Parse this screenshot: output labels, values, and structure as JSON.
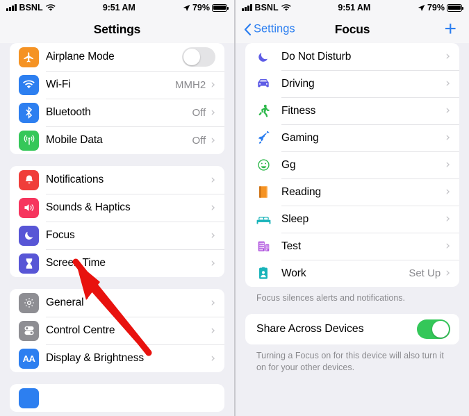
{
  "status_bar": {
    "carrier": "BSNL",
    "time": "9:51 AM",
    "battery_percent": "79%",
    "signal_icon": "cellular-bars-icon",
    "wifi_icon": "wifi-icon",
    "location_icon": "location-arrow-icon",
    "battery_icon": "battery-icon"
  },
  "left_screen": {
    "title": "Settings",
    "groups": [
      {
        "rows": [
          {
            "label": "Airplane Mode",
            "icon": "airplane-icon",
            "color": "#f59324",
            "control": "toggle",
            "toggle_on": false
          },
          {
            "label": "Wi-Fi",
            "icon": "wifi-icon",
            "color": "#2d7ff0",
            "value": "MMH2",
            "control": "chevron"
          },
          {
            "label": "Bluetooth",
            "icon": "bluetooth-icon",
            "color": "#2d7ff0",
            "value": "Off",
            "control": "chevron"
          },
          {
            "label": "Mobile Data",
            "icon": "cellular-tower-icon",
            "color": "#35c759",
            "value": "Off",
            "control": "chevron"
          }
        ]
      },
      {
        "rows": [
          {
            "label": "Notifications",
            "icon": "bell-icon",
            "color": "#f03e3a",
            "value": "",
            "control": "chevron"
          },
          {
            "label": "Sounds & Haptics",
            "icon": "speaker-icon",
            "color": "#f6355e",
            "value": "",
            "control": "chevron"
          },
          {
            "label": "Focus",
            "icon": "moon-icon",
            "color": "#5856d6",
            "value": "",
            "control": "chevron"
          },
          {
            "label": "Screen Time",
            "icon": "hourglass-icon",
            "color": "#5856d6",
            "value": "",
            "control": "chevron"
          }
        ]
      },
      {
        "rows": [
          {
            "label": "General",
            "icon": "gear-icon",
            "color": "#8e8e93",
            "value": "",
            "control": "chevron"
          },
          {
            "label": "Control Centre",
            "icon": "control-toggles-icon",
            "color": "#8e8e93",
            "value": "",
            "control": "chevron"
          },
          {
            "label": "Display & Brightness",
            "icon": "text-size-icon",
            "color": "#2d7ff0",
            "value": "",
            "control": "chevron"
          }
        ]
      }
    ],
    "annotation": {
      "type": "red-arrow",
      "points_to": "Focus",
      "color": "#e8120e"
    }
  },
  "right_screen": {
    "back_label": "Settings",
    "title": "Focus",
    "add_label": "+",
    "focus_modes": [
      {
        "label": "Do Not Disturb",
        "icon": "moon-icon",
        "color": "#5e5ce6",
        "value": ""
      },
      {
        "label": "Driving",
        "icon": "car-icon",
        "color": "#5e5ce6",
        "value": ""
      },
      {
        "label": "Fitness",
        "icon": "runner-icon",
        "color": "#30b94d",
        "value": ""
      },
      {
        "label": "Gaming",
        "icon": "rocket-icon",
        "color": "#2d7ff0",
        "value": ""
      },
      {
        "label": "Gg",
        "icon": "smiley-icon",
        "color": "#30b94d",
        "value": ""
      },
      {
        "label": "Reading",
        "icon": "book-icon",
        "color": "#f59324",
        "value": ""
      },
      {
        "label": "Sleep",
        "icon": "bed-icon",
        "color": "#17b3b9",
        "value": ""
      },
      {
        "label": "Test",
        "icon": "buildings-icon",
        "color": "#af52de",
        "value": ""
      },
      {
        "label": "Work",
        "icon": "id-badge-icon",
        "color": "#17b3b9",
        "value": "Set Up"
      }
    ],
    "focus_footnote": "Focus silences alerts and notifications.",
    "share": {
      "label": "Share Across Devices",
      "toggle_on": true,
      "footnote": "Turning a Focus on for this device will also turn it on for your other devices."
    }
  }
}
